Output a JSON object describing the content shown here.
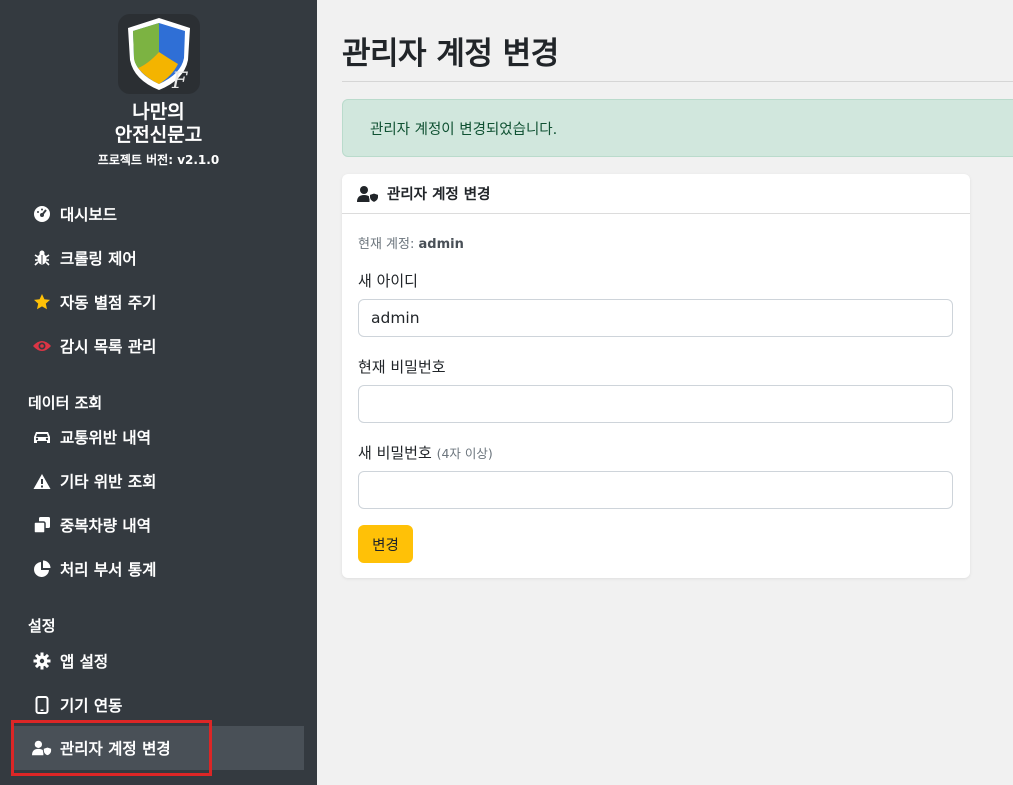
{
  "app": {
    "name_line1": "나만의",
    "name_line2": "안전신문고",
    "version": "프로젝트 버전: v2.1.0"
  },
  "sidebar": {
    "items": [
      {
        "label": "대시보드",
        "icon": "dashboard-icon"
      },
      {
        "label": "크롤링 제어",
        "icon": "bug-icon"
      },
      {
        "label": "자동 별점 주기",
        "icon": "star-icon"
      },
      {
        "label": "감시 목록 관리",
        "icon": "eye-icon"
      }
    ],
    "section_data": "데이터 조회",
    "data_items": [
      {
        "label": "교통위반 내역",
        "icon": "car-icon"
      },
      {
        "label": "기타 위반 조회",
        "icon": "warning-icon"
      },
      {
        "label": "중복차량 내역",
        "icon": "copy-icon"
      },
      {
        "label": "처리 부서 통계",
        "icon": "pie-chart-icon"
      }
    ],
    "section_settings": "설정",
    "settings_items": [
      {
        "label": "앱 설정",
        "icon": "gear-icon"
      },
      {
        "label": "기기 연동",
        "icon": "mobile-icon"
      },
      {
        "label": "관리자 계정 변경",
        "icon": "user-shield-icon",
        "active": true
      }
    ]
  },
  "main": {
    "title": "관리자 계정 변경",
    "alert": "관리자 계정이 변경되었습니다.",
    "card": {
      "title": "관리자 계정 변경",
      "current_prefix": "현재 계정: ",
      "current_account": "admin",
      "new_id_label": "새 아이디",
      "new_id_value": "admin",
      "current_pw_label": "현재 비밀번호",
      "current_pw_value": "",
      "new_pw_label": "새 비밀번호",
      "new_pw_hint": "(4자 이상)",
      "new_pw_value": "",
      "submit_label": "변경"
    }
  },
  "colors": {
    "sidebar_bg": "#343a40",
    "active_bg": "#495057",
    "alert_bg": "#d1e7dd",
    "button": "#ffc107",
    "highlight": "#dc2626"
  }
}
